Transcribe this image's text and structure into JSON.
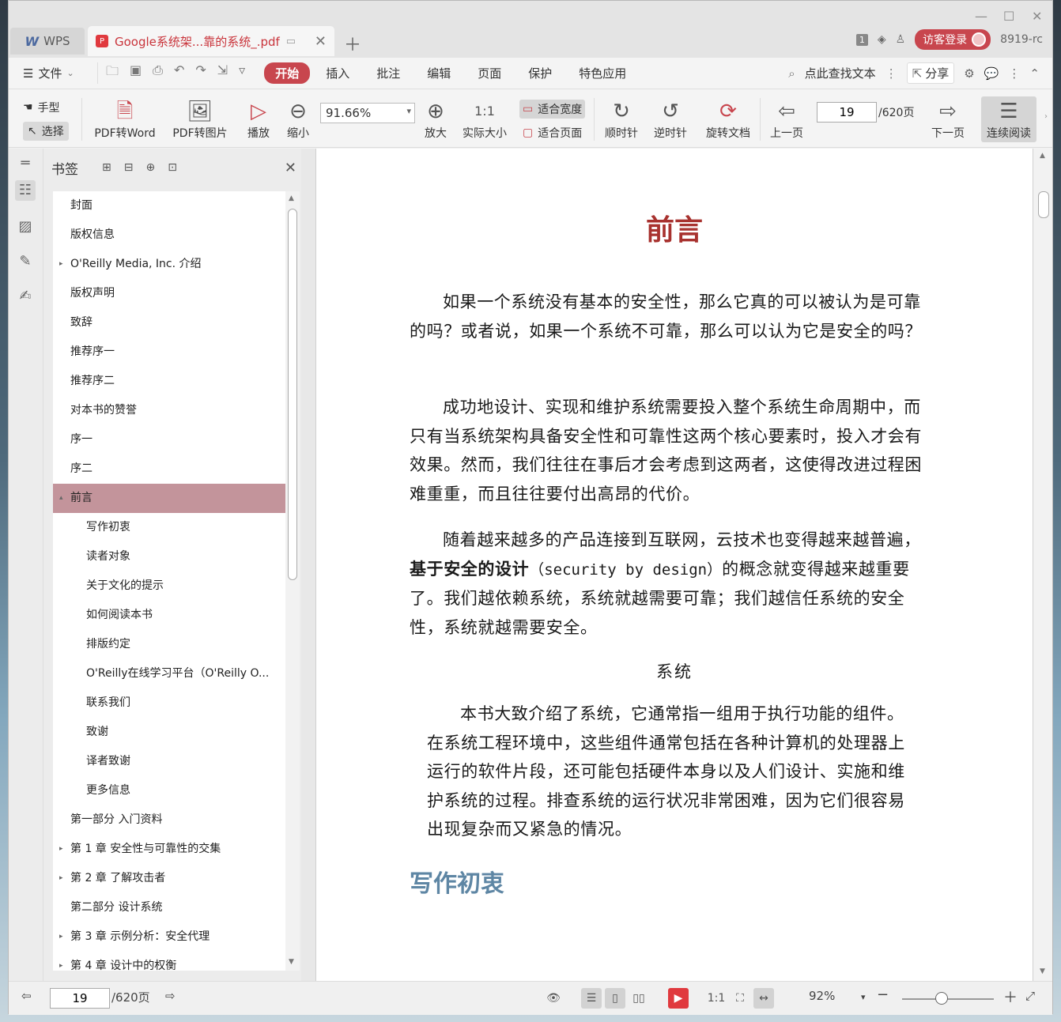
{
  "window": {
    "app_tab": "WPS",
    "doc_tab": "Google系统架...靠的系统_.pdf",
    "counter": "1",
    "login": "访客登录",
    "user_id": "8919-rc"
  },
  "menubar": {
    "file": "文件",
    "tabs": [
      "开始",
      "插入",
      "批注",
      "编辑",
      "页面",
      "保护",
      "特色应用"
    ],
    "search": "点此查找文本",
    "share": "分享"
  },
  "toolbar": {
    "hand": "手型",
    "select": "选择",
    "pdf_to_word": "PDF转Word",
    "pdf_to_image": "PDF转图片",
    "play": "播放",
    "zoom_out": "缩小",
    "zoom_value": "91.66%",
    "zoom_in": "放大",
    "actual_size": "实际大小",
    "fit_width": "适合宽度",
    "fit_page": "适合页面",
    "clockwise": "顺时针",
    "counterclockwise": "逆时针",
    "rotate_doc": "旋转文档",
    "prev_page": "上一页",
    "page_current": "19",
    "page_total": "/620页",
    "next_page": "下一页",
    "continuous": "连续阅读"
  },
  "bookmarks": {
    "title": "书签",
    "items": [
      {
        "label": "封面",
        "level": 1,
        "caret": ""
      },
      {
        "label": "版权信息",
        "level": 1,
        "caret": ""
      },
      {
        "label": "O'Reilly Media, Inc. 介绍",
        "level": 1,
        "caret": "▸"
      },
      {
        "label": "版权声明",
        "level": 1,
        "caret": ""
      },
      {
        "label": "致辞",
        "level": 1,
        "caret": ""
      },
      {
        "label": "推荐序一",
        "level": 1,
        "caret": ""
      },
      {
        "label": "推荐序二",
        "level": 1,
        "caret": ""
      },
      {
        "label": "对本书的赞誉",
        "level": 1,
        "caret": ""
      },
      {
        "label": "序一",
        "level": 1,
        "caret": ""
      },
      {
        "label": "序二",
        "level": 1,
        "caret": ""
      },
      {
        "label": "前言",
        "level": 1,
        "caret": "▴",
        "active": true
      },
      {
        "label": "写作初衷",
        "level": 2,
        "caret": ""
      },
      {
        "label": "读者对象",
        "level": 2,
        "caret": ""
      },
      {
        "label": "关于文化的提示",
        "level": 2,
        "caret": ""
      },
      {
        "label": "如何阅读本书",
        "level": 2,
        "caret": ""
      },
      {
        "label": "排版约定",
        "level": 2,
        "caret": ""
      },
      {
        "label": "O'Reilly在线学习平台（O'Reilly O...",
        "level": 2,
        "caret": ""
      },
      {
        "label": "联系我们",
        "level": 2,
        "caret": ""
      },
      {
        "label": "致谢",
        "level": 2,
        "caret": ""
      },
      {
        "label": "译者致谢",
        "level": 2,
        "caret": ""
      },
      {
        "label": "更多信息",
        "level": 2,
        "caret": ""
      },
      {
        "label": "第一部分 入门资料",
        "level": 1,
        "caret": ""
      },
      {
        "label": "第 1 章 安全性与可靠性的交集",
        "level": 1,
        "caret": "▸"
      },
      {
        "label": "第 2 章 了解攻击者",
        "level": 1,
        "caret": "▸"
      },
      {
        "label": "第二部分 设计系统",
        "level": 1,
        "caret": ""
      },
      {
        "label": "第 3 章 示例分析：安全代理",
        "level": 1,
        "caret": "▸"
      },
      {
        "label": "第 4 章 设计中的权衡",
        "level": 1,
        "caret": "▸"
      }
    ]
  },
  "document": {
    "title": "前言",
    "para1": "如果一个系统没有基本的安全性，那么它真的可以被认为是可靠的吗？或者说，如果一个系统不可靠，那么可以认为它是安全的吗？",
    "para2": "成功地设计、实现和维护系统需要投入整个系统生命周期中，而只有当系统架构具备安全性和可靠性这两个核心要素时，投入才会有效果。然而，我们往往在事后才会考虑到这两者，这使得改进过程困难重重，而且往往要付出高昂的代价。",
    "para3_a": "随着越来越多的产品连接到互联网，云技术也变得越来越普遍，",
    "para3_bold": "基于安全的设计",
    "para3_mono": "（security by design）",
    "para3_b": "的概念就变得越来越重要了。我们越依赖系统，系统就越需要可靠；我们越信任系统的安全性，系统就越需要安全。",
    "sidebar_heading": "系统",
    "sidebar_text": "本书大致介绍了系统，它通常指一组用于执行功能的组件。在系统工程环境中，这些组件通常包括在各种计算机的处理器上运行的软件片段，还可能包括硬件本身以及人们设计、实施和维护系统的过程。排查系统的运行状况非常困难，因为它们很容易出现复杂而又紧急的情况。",
    "section_heading": "写作初衷"
  },
  "status": {
    "page_current": "19",
    "page_total": "/620页",
    "zoom": "92%",
    "zoom_slider_percent": 43
  }
}
